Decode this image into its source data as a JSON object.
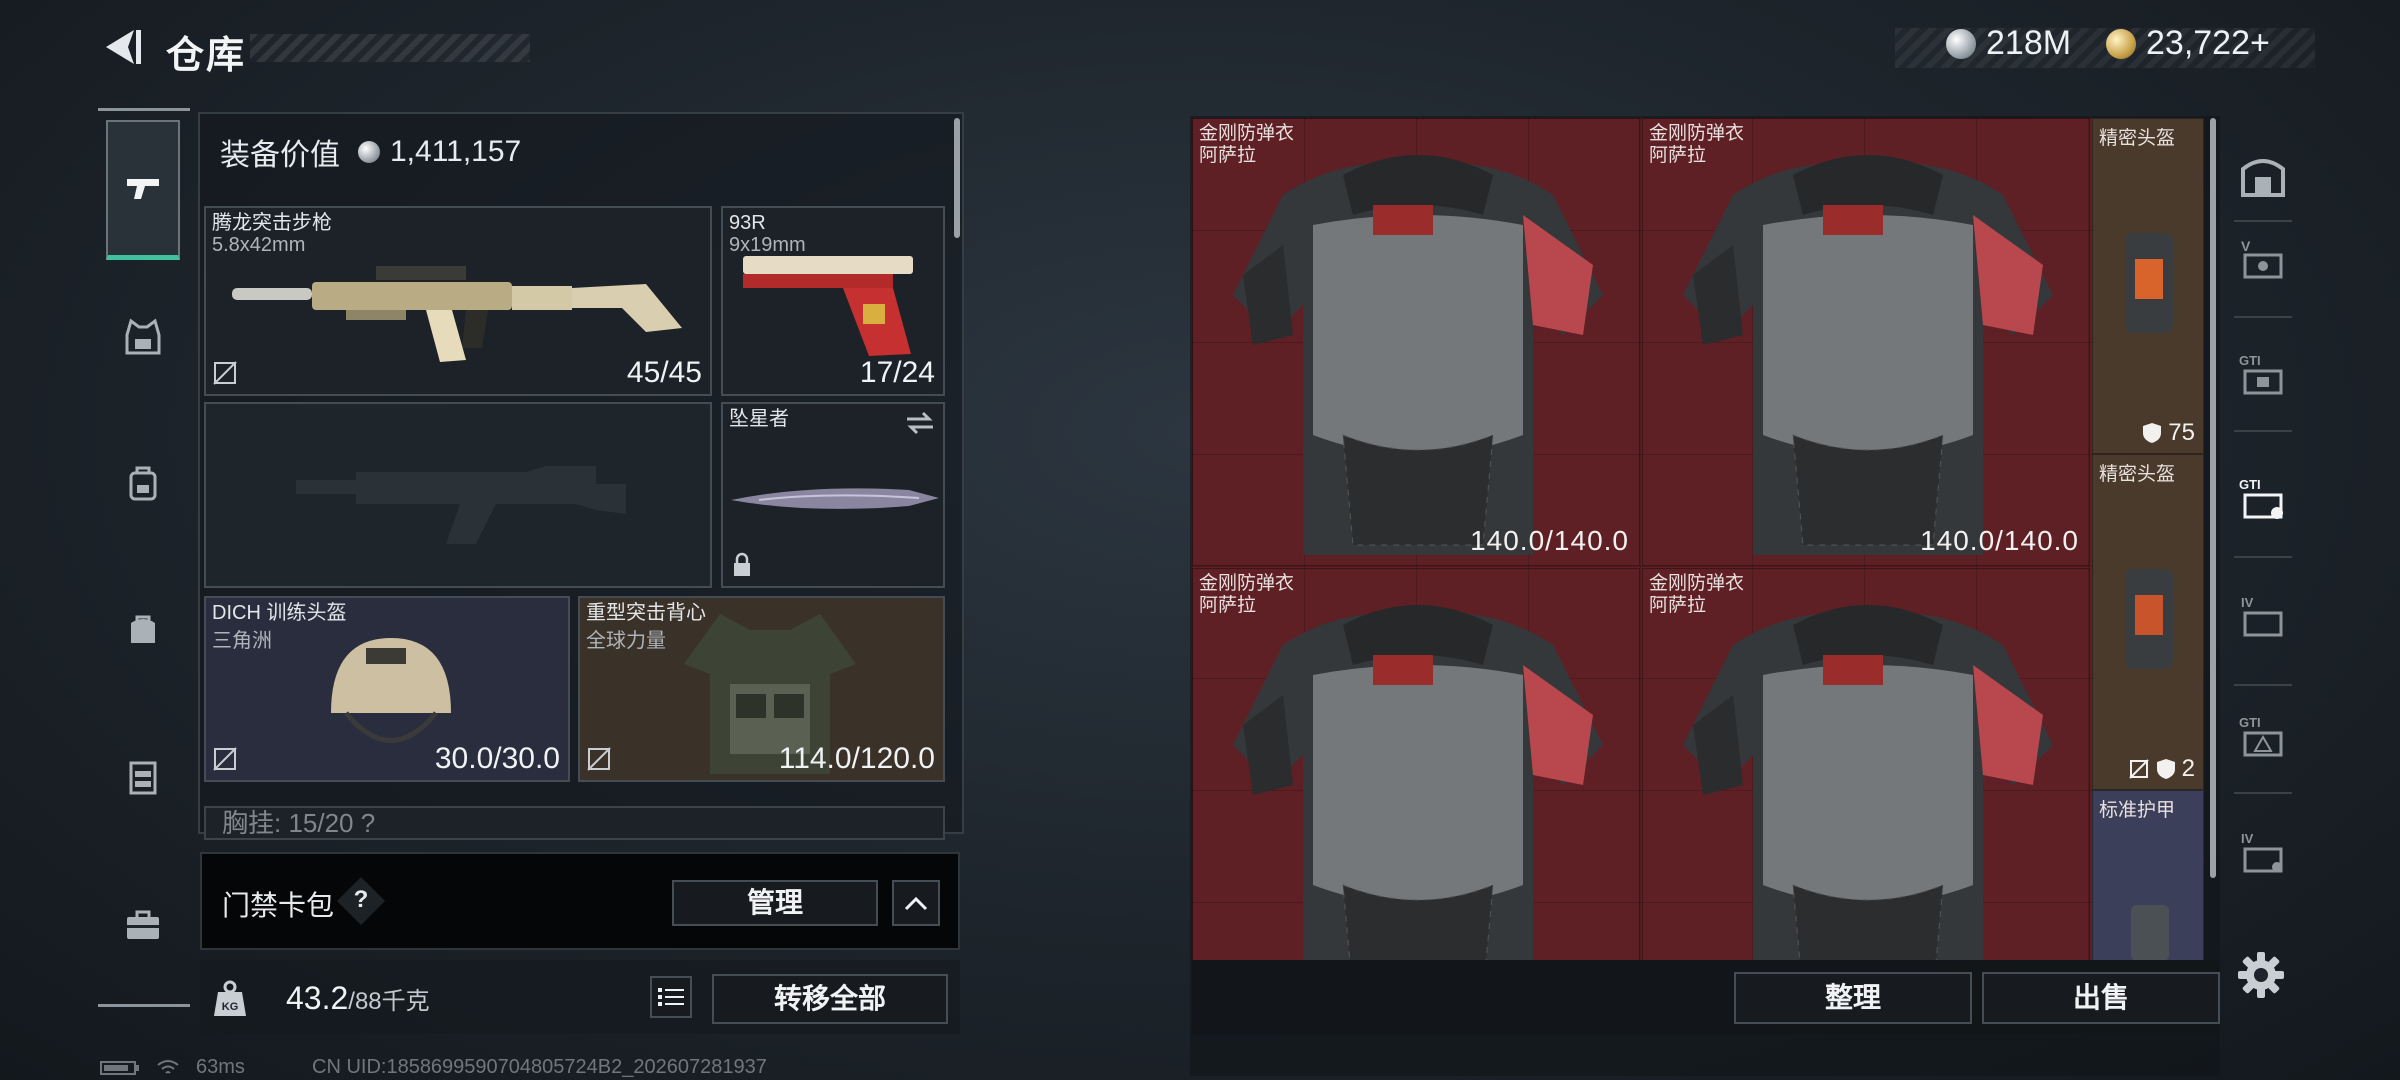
{
  "header": {
    "title": "仓库",
    "currency_silver": "218M",
    "currency_gold": "23,722+",
    "icons": [
      "back-arrow-icon",
      "silver-coin-icon",
      "gold-coin-icon"
    ]
  },
  "left_nav": {
    "items": [
      "pistol-icon",
      "armor-vest-icon",
      "backpack-icon",
      "bag-icon",
      "chest-rig-icon",
      "briefcase-icon"
    ],
    "active": "pistol-icon"
  },
  "loadout": {
    "value_label": "装备价值",
    "value": "1,411,157",
    "rifle": {
      "name": "腾龙突击步枪",
      "caliber": "5.8x42mm",
      "ammo": "45/45"
    },
    "pistol": {
      "name": "93R",
      "caliber": "9x19mm",
      "ammo": "17/24"
    },
    "knife": {
      "name": "坠星者"
    },
    "helmet": {
      "name": "DICH 训练头盔",
      "faction": "三角洲",
      "durability": "30.0/30.0"
    },
    "vest": {
      "name": "重型突击背心",
      "faction": "全球力量",
      "durability": "114.0/120.0"
    },
    "chest_rig": {
      "label": "胸挂: 15/20 ?"
    }
  },
  "card_pack": {
    "label": "门禁卡包",
    "help": "?",
    "manage_label": "管理"
  },
  "weight": {
    "current": "43.2",
    "max": "/88千克",
    "transfer_label": "转移全部"
  },
  "status": {
    "ping": "63ms",
    "uid": "CN UID:1858699590704805724B2_202607281937"
  },
  "storage": {
    "armors": [
      {
        "name": "金刚防弹衣",
        "origin": "阿萨拉",
        "durability": "140.0/140.0"
      },
      {
        "name": "金刚防弹衣",
        "origin": "阿萨拉",
        "durability": "140.0/140.0"
      },
      {
        "name": "金刚防弹衣",
        "origin": "阿萨拉",
        "durability": ""
      },
      {
        "name": "金刚防弹衣",
        "origin": "阿萨拉",
        "durability": ""
      }
    ],
    "side_items": [
      {
        "name": "精密头盔",
        "stat": "75"
      },
      {
        "name": "精密头盔",
        "stat": "2"
      },
      {
        "name": "标准护甲",
        "stat": ""
      }
    ],
    "sort_label": "整理",
    "sell_label": "出售"
  },
  "right_nav": {
    "items": [
      "safe-box-icon",
      "vault-v-icon",
      "vault-gti-icon",
      "vault-gti-active-icon",
      "vault-iv-icon",
      "vault-gti-2-icon",
      "vault-iv-2-icon",
      "settings-gear-icon"
    ]
  },
  "colors": {
    "accent": "#43c0a0",
    "storage_red": "#5e2024",
    "helmet_slot": "#2a2d3e",
    "vest_slot": "#3a3128"
  }
}
